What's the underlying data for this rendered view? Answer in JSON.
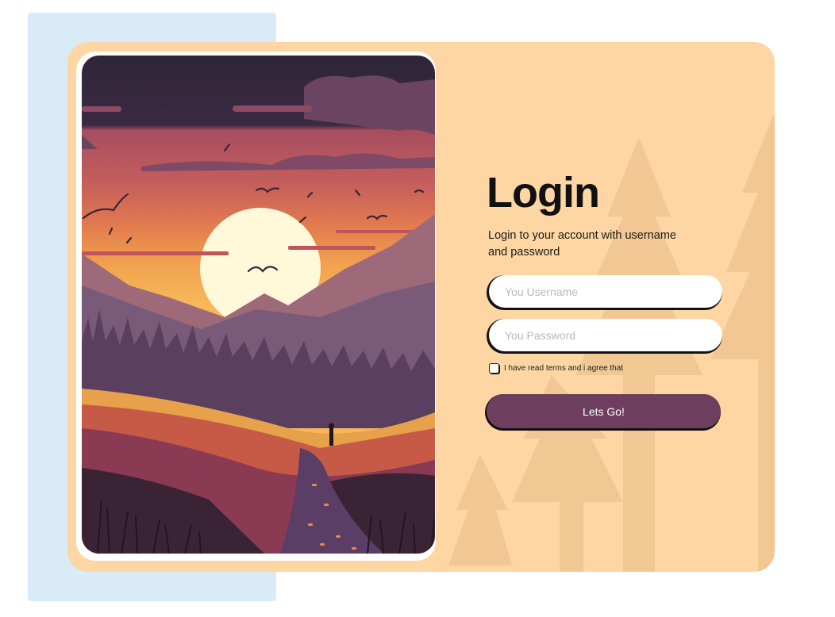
{
  "login": {
    "title": "Login",
    "subtitle": "Login to your account with username and password",
    "username_placeholder": "You Username",
    "password_placeholder": "You Password",
    "terms_label": "I have read terms and i agree that",
    "submit_label": "Lets Go!"
  },
  "colors": {
    "card_background": "#fdd6a3",
    "side_panel": "#d9ebf7",
    "button": "#6e3e5f"
  },
  "illustration": {
    "subject": "sunset-mountain-landscape"
  }
}
